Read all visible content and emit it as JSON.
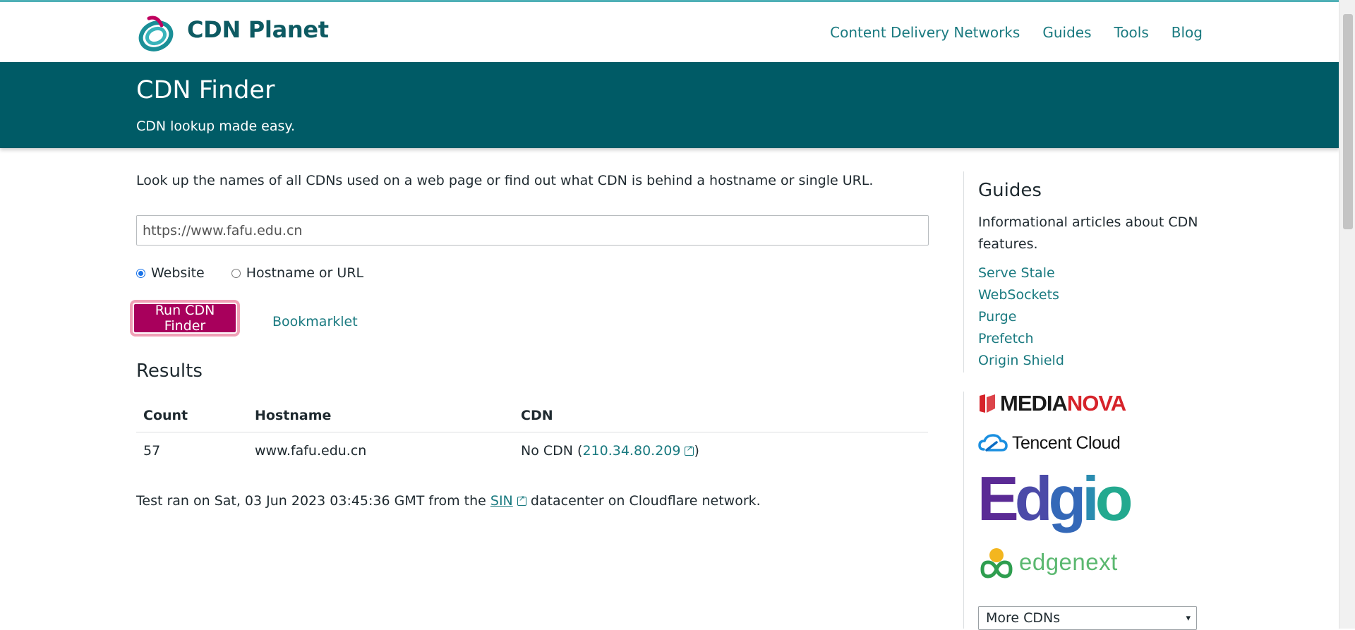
{
  "header": {
    "brand": "CDN Planet",
    "nav": [
      "Content Delivery Networks",
      "Guides",
      "Tools",
      "Blog"
    ]
  },
  "hero": {
    "title": "CDN Finder",
    "subtitle": "CDN lookup made easy."
  },
  "main": {
    "intro": "Look up the names of all CDNs used on a web page or find out what CDN is behind a hostname or single URL.",
    "url_value": "https://www.fafu.edu.cn",
    "radio_options": [
      {
        "label": "Website",
        "checked": true
      },
      {
        "label": "Hostname or URL",
        "checked": false
      }
    ],
    "run_button": "Run CDN Finder",
    "bookmarklet": "Bookmarklet",
    "results_title": "Results",
    "table": {
      "headers": [
        "Count",
        "Hostname",
        "CDN"
      ],
      "rows": [
        {
          "count": "57",
          "hostname": "www.fafu.edu.cn",
          "cdn_prefix": "No CDN (",
          "ip": "210.34.80.209",
          "cdn_suffix": ")"
        }
      ]
    },
    "test_line": {
      "before": "Test ran on Sat, 03 Jun 2023 03:45:36 GMT from the ",
      "datacenter": "SIN",
      "after": " datacenter on Cloudflare network."
    }
  },
  "sidebar": {
    "title": "Guides",
    "description": "Informational articles about CDN features.",
    "links": [
      "Serve Stale",
      "WebSockets",
      "Purge",
      "Prefetch",
      "Origin Shield"
    ],
    "sponsors": {
      "mediannova": [
        "MEDIA",
        "NOVA"
      ],
      "tencent": "Tencent Cloud",
      "edgio": [
        "E",
        "d",
        "g",
        "i",
        "o"
      ],
      "edgenext": "edgenext"
    },
    "more_select": "More CDNs"
  },
  "colors": {
    "brand_teal": "#005b66",
    "link": "#1a7a80",
    "button": "#a8005c"
  }
}
